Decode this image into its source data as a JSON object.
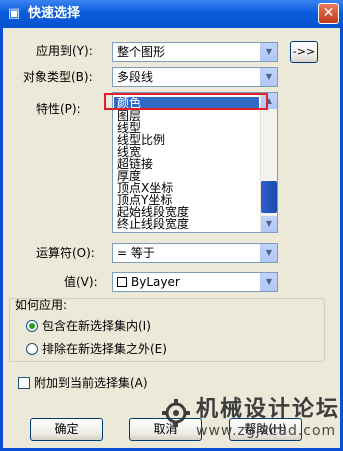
{
  "window": {
    "title": "快速选择",
    "close_label": "✕"
  },
  "form": {
    "apply_to": {
      "label": "应用到(Y):",
      "value": "整个图形"
    },
    "pick_button_label": "->>",
    "object_type": {
      "label": "对象类型(B):",
      "value": "多段线"
    },
    "properties": {
      "label": "特性(P):",
      "items": [
        "颜色",
        "图层",
        "线型",
        "线型比例",
        "线宽",
        "超链接",
        "厚度",
        "顶点X坐标",
        "顶点Y坐标",
        "起始线段宽度",
        "终止线段宽度"
      ],
      "selected_index": 0
    },
    "operator": {
      "label": "运算符(O):",
      "value": "= 等于"
    },
    "value": {
      "label": "值(V):",
      "value": "ByLayer"
    }
  },
  "how_to_apply": {
    "label": "如何应用:",
    "include_label": "包含在新选择集内(I)",
    "exclude_label": "排除在新选择集之外(E)",
    "selected": "include"
  },
  "append_label": "附加到当前选择集(A)",
  "buttons": {
    "ok": "确定",
    "cancel": "取消",
    "help": "帮助(H)"
  },
  "watermark": {
    "text": "机械设计论坛",
    "url": "www.zgjxcad.com"
  },
  "colors": {
    "titlebar": "#0a5cdc",
    "selection": "#316ac5",
    "highlight_box": "#e0202c",
    "radio_dot": "#21a121"
  }
}
